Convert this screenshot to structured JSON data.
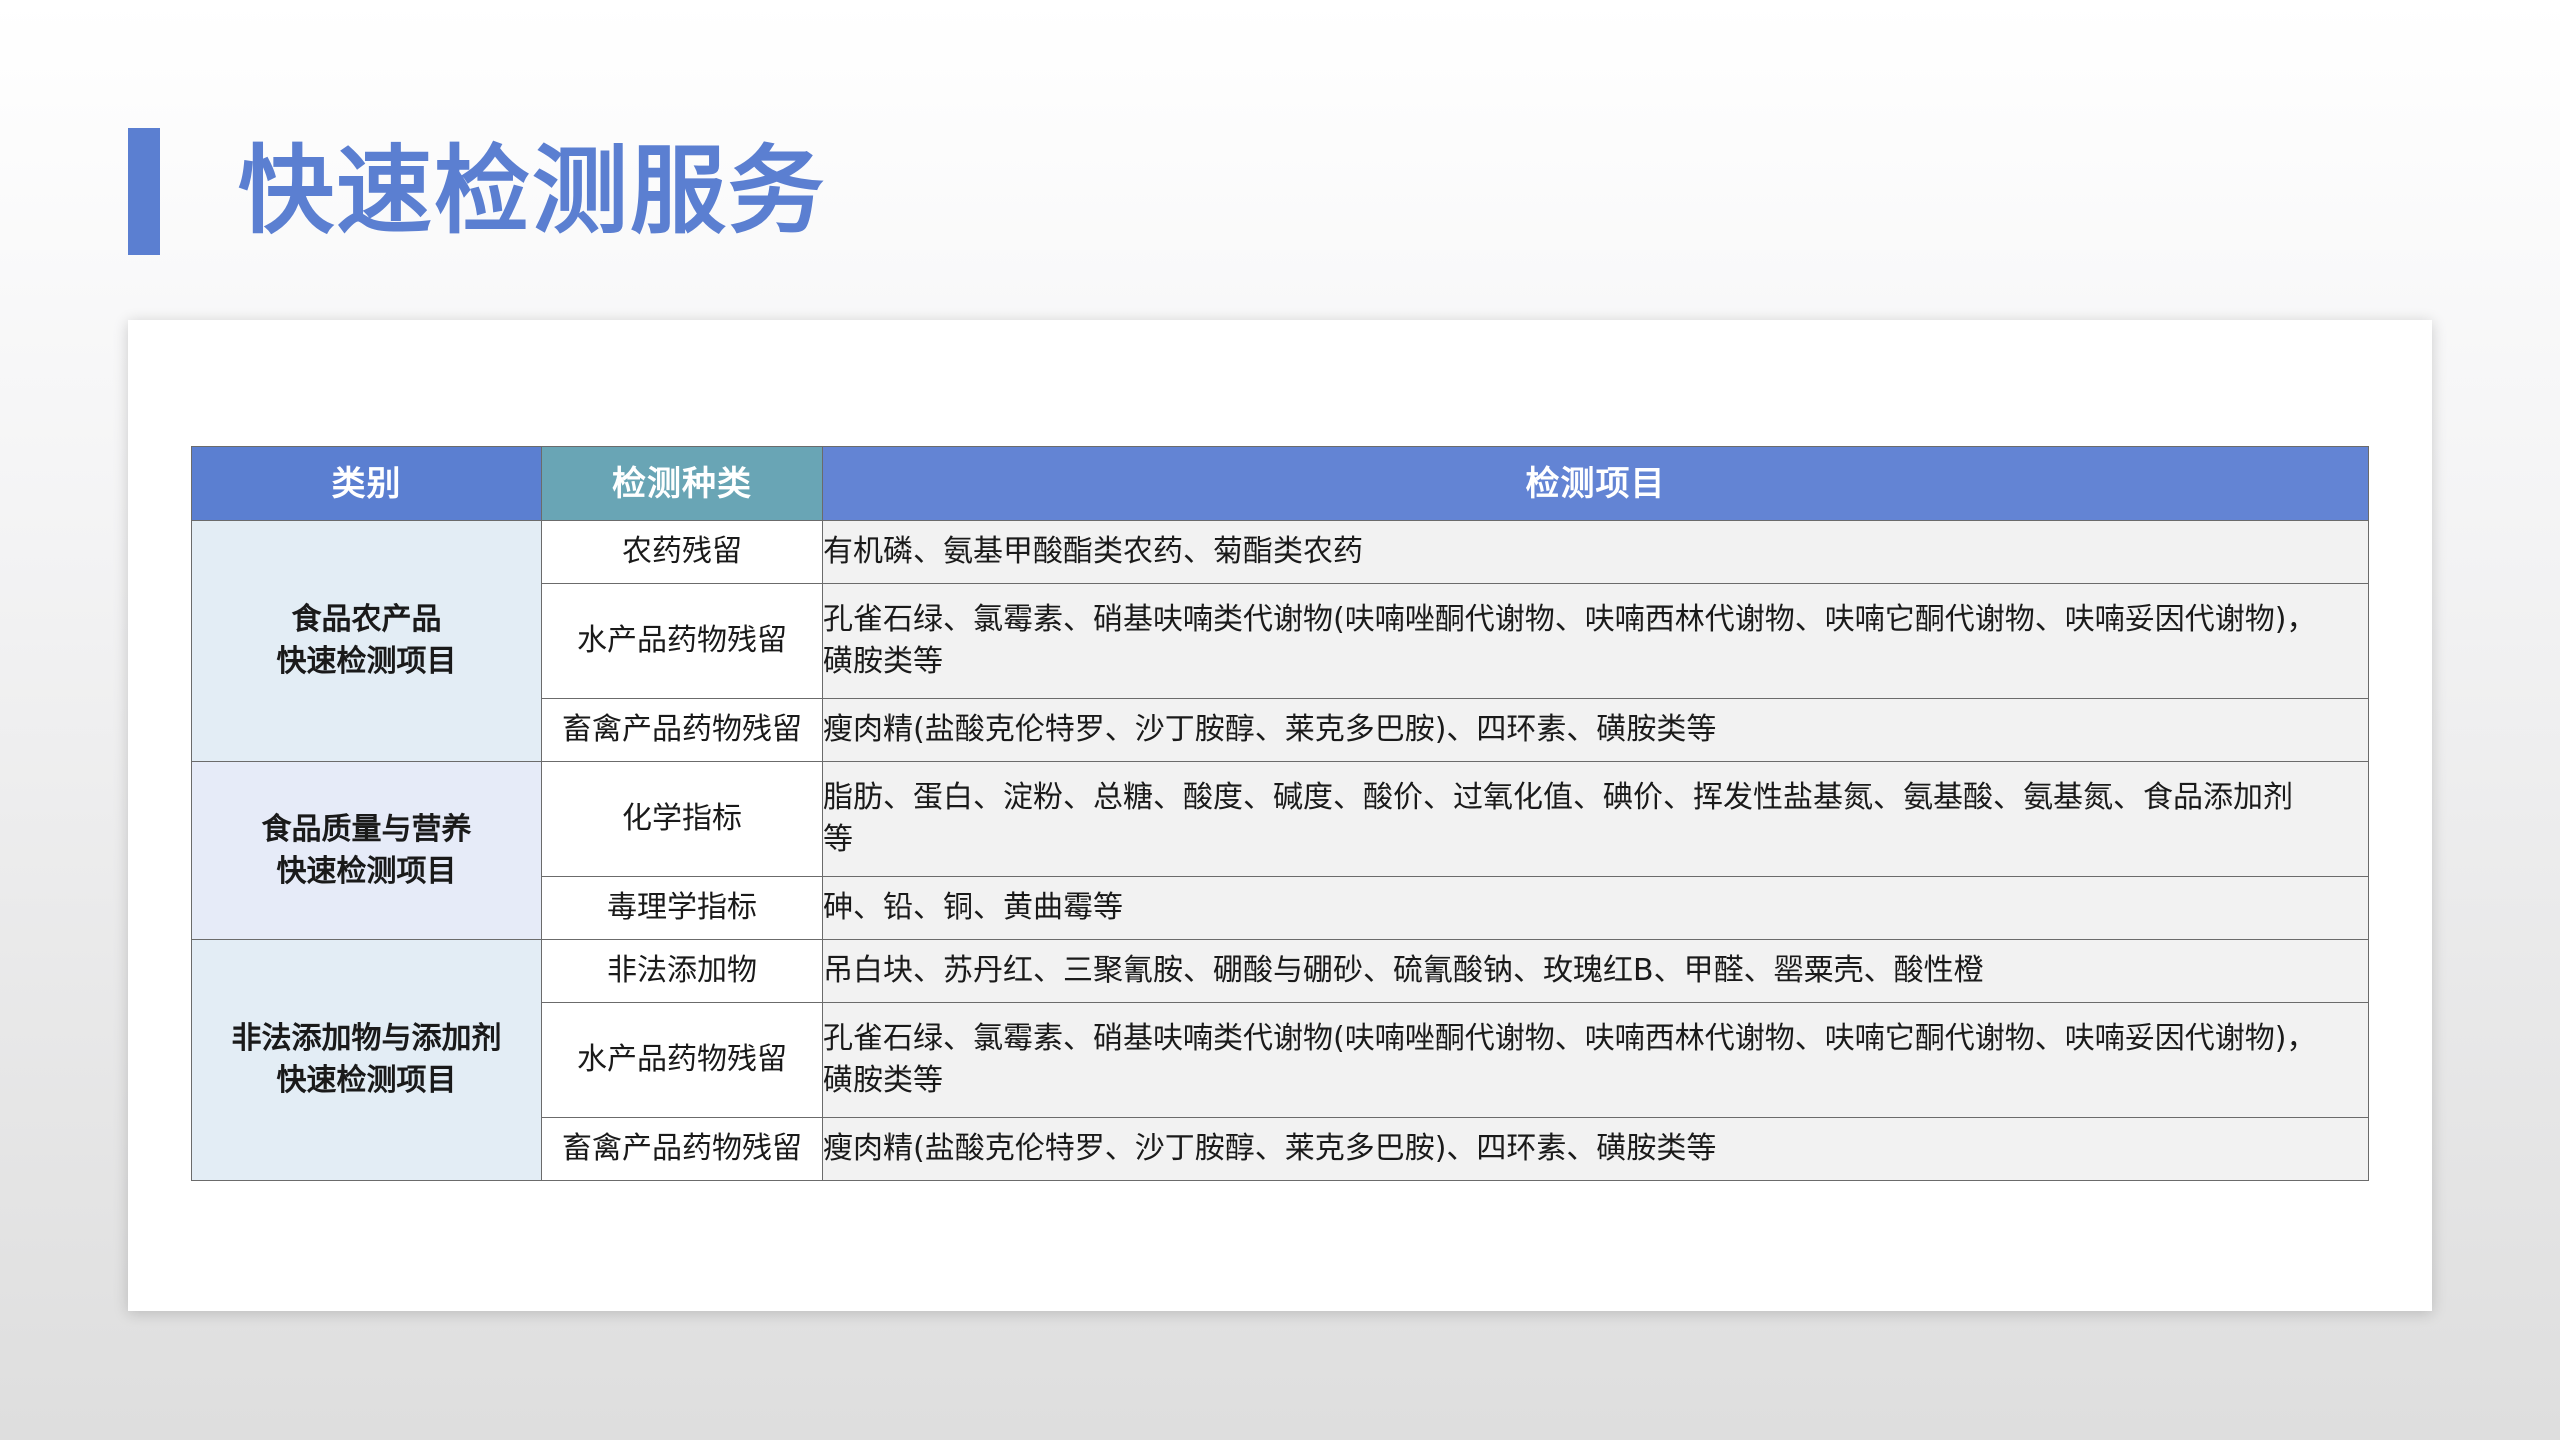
{
  "title": "快速检测服务",
  "table": {
    "headers": [
      "类别",
      "检测种类",
      "检测项目"
    ],
    "groups": [
      {
        "category": [
          "食品农产品",
          "快速检测项目"
        ],
        "rows": [
          {
            "kind": "农药残留",
            "items": [
              "有机磷、氨基甲酸酯类农药、菊酯类农药"
            ]
          },
          {
            "kind": "水产品药物残留",
            "items": [
              "孔雀石绿、氯霉素、硝基呋喃类代谢物(呋喃唑酮代谢物、呋喃西林代谢物、呋喃它酮代谢物、呋喃妥因代谢物)，",
              "磺胺类等"
            ]
          },
          {
            "kind": "畜禽产品药物残留",
            "items": [
              "瘦肉精(盐酸克伦特罗、沙丁胺醇、莱克多巴胺)、四环素、磺胺类等"
            ]
          }
        ]
      },
      {
        "category": [
          "食品质量与营养",
          "快速检测项目"
        ],
        "rows": [
          {
            "kind": "化学指标",
            "items": [
              "脂肪、蛋白、淀粉、总糖、酸度、碱度、酸价、过氧化值、碘价、挥发性盐基氮、氨基酸、氨基氮、食品添加剂",
              "等"
            ]
          },
          {
            "kind": "毒理学指标",
            "items": [
              "砷、铅、铜、黄曲霉等"
            ]
          }
        ]
      },
      {
        "category": [
          "非法添加物与添加剂",
          "快速检测项目"
        ],
        "rows": [
          {
            "kind": "非法添加物",
            "items": [
              "吊白块、苏丹红、三聚氰胺、硼酸与硼砂、硫氰酸钠、玫瑰红B、甲醛、罂粟壳、酸性橙"
            ]
          },
          {
            "kind": "水产品药物残留",
            "items": [
              "孔雀石绿、氯霉素、硝基呋喃类代谢物(呋喃唑酮代谢物、呋喃西林代谢物、呋喃它酮代谢物、呋喃妥因代谢物)，",
              "磺胺类等"
            ]
          },
          {
            "kind": "畜禽产品药物残留",
            "items": [
              "瘦肉精(盐酸克伦特罗、沙丁胺醇、莱克多巴胺)、四环素、磺胺类等"
            ]
          }
        ]
      }
    ]
  },
  "colors": {
    "accent": "#5b7fd1",
    "header_col1": "#5b7fd1",
    "header_col2": "#69a5b5",
    "header_col3": "#6384d4",
    "category_bg": "#e3edf5",
    "item_bg": "#f2f2f2"
  }
}
